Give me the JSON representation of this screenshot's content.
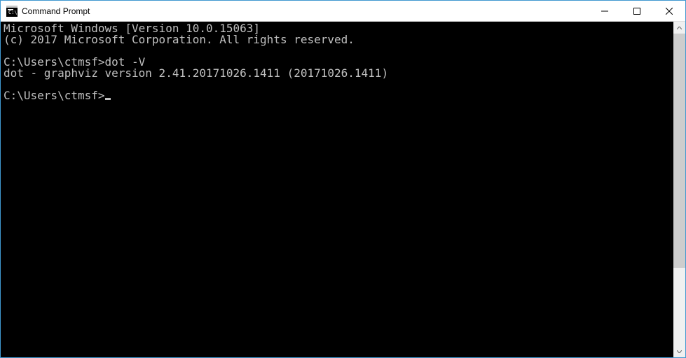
{
  "titlebar": {
    "title": "Command Prompt"
  },
  "terminal": {
    "lines": [
      "Microsoft Windows [Version 10.0.15063]",
      "(c) 2017 Microsoft Corporation. All rights reserved.",
      "",
      "C:\\Users\\ctmsf>dot -V",
      "dot - graphviz version 2.41.20171026.1411 (20171026.1411)",
      "",
      "C:\\Users\\ctmsf>"
    ]
  }
}
